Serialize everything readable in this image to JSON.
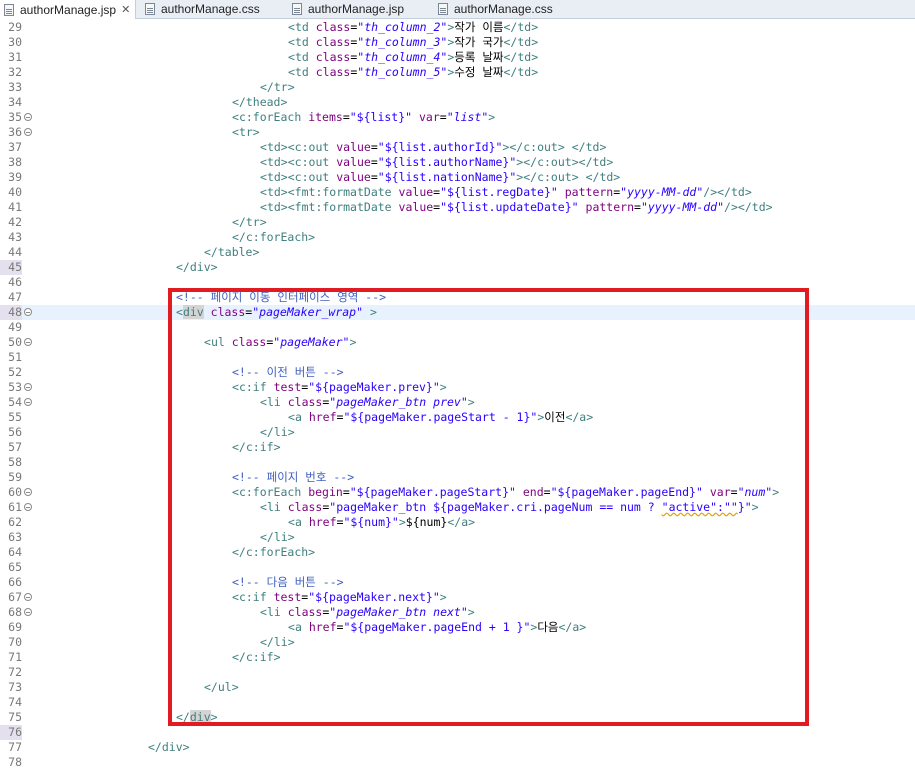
{
  "tabs": [
    {
      "label": "authorManage.jsp",
      "active": true,
      "close": "✕"
    },
    {
      "label": "authorManage.css",
      "active": false
    },
    {
      "label": "authorManage.jsp",
      "active": false
    },
    {
      "label": "authorManage.css",
      "active": false
    }
  ],
  "lines": [
    {
      "n": "29",
      "text": "<td class=\"th_column_2\">작가 이름</td>"
    },
    {
      "n": "30",
      "text": "<td class=\"th_column_3\">작가 국가</td>"
    },
    {
      "n": "31",
      "text": "<td class=\"th_column_4\">등록 날짜</td>"
    },
    {
      "n": "32",
      "text": "<td class=\"th_column_5\">수정 날짜</td>"
    },
    {
      "n": "33",
      "text": "</tr>"
    },
    {
      "n": "34",
      "text": "</thead>"
    },
    {
      "n": "35",
      "text": "<c:forEach items=\"${list}\" var=\"list\">"
    },
    {
      "n": "36",
      "text": "<tr>"
    },
    {
      "n": "37",
      "text": "<td><c:out value=\"${list.authorId}\"></c:out> </td>"
    },
    {
      "n": "38",
      "text": "<td><c:out value=\"${list.authorName}\"></c:out></td>"
    },
    {
      "n": "39",
      "text": "<td><c:out value=\"${list.nationName}\"></c:out> </td>"
    },
    {
      "n": "40",
      "text": "<td><fmt:formatDate value=\"${list.regDate}\" pattern=\"yyyy-MM-dd\"/></td>"
    },
    {
      "n": "41",
      "text": "<td><fmt:formatDate value=\"${list.updateDate}\" pattern=\"yyyy-MM-dd\"/></td>"
    },
    {
      "n": "42",
      "text": "</tr>"
    },
    {
      "n": "43",
      "text": "</c:forEach>"
    },
    {
      "n": "44",
      "text": "</table>"
    },
    {
      "n": "45",
      "text": "</div>"
    },
    {
      "n": "46",
      "text": ""
    },
    {
      "n": "47",
      "text": "<!-- 페이지 이동 인터페이스 영역 -->"
    },
    {
      "n": "48",
      "text": "<div class=\"pageMaker_wrap\" >"
    },
    {
      "n": "49",
      "text": ""
    },
    {
      "n": "50",
      "text": "<ul class=\"pageMaker\">"
    },
    {
      "n": "51",
      "text": ""
    },
    {
      "n": "52",
      "text": "<!-- 이전 버튼 -->"
    },
    {
      "n": "53",
      "text": "<c:if test=\"${pageMaker.prev}\">"
    },
    {
      "n": "54",
      "text": "<li class=\"pageMaker_btn prev\">"
    },
    {
      "n": "55",
      "text": "<a href=\"${pageMaker.pageStart - 1}\">이전</a>"
    },
    {
      "n": "56",
      "text": "</li>"
    },
    {
      "n": "57",
      "text": "</c:if>"
    },
    {
      "n": "58",
      "text": ""
    },
    {
      "n": "59",
      "text": "<!-- 페이지 번호 -->"
    },
    {
      "n": "60",
      "text": "<c:forEach begin=\"${pageMaker.pageStart}\" end=\"${pageMaker.pageEnd}\" var=\"num\">"
    },
    {
      "n": "61",
      "text": "<li class=\"pageMaker_btn ${pageMaker.cri.pageNum == num ? \"active\":\"\"}\">"
    },
    {
      "n": "62",
      "text": "<a href=\"${num}\">${num}</a>"
    },
    {
      "n": "63",
      "text": "</li>"
    },
    {
      "n": "64",
      "text": "</c:forEach>"
    },
    {
      "n": "65",
      "text": ""
    },
    {
      "n": "66",
      "text": "<!-- 다음 버튼 -->"
    },
    {
      "n": "67",
      "text": "<c:if test=\"${pageMaker.next}\">"
    },
    {
      "n": "68",
      "text": "<li class=\"pageMaker_btn next\">"
    },
    {
      "n": "69",
      "text": "<a href=\"${pageMaker.pageEnd + 1 }\">다음</a>"
    },
    {
      "n": "70",
      "text": "</li>"
    },
    {
      "n": "71",
      "text": "</c:if>"
    },
    {
      "n": "72",
      "text": ""
    },
    {
      "n": "73",
      "text": "</ul>"
    },
    {
      "n": "74",
      "text": ""
    },
    {
      "n": "75",
      "text": "</div>"
    },
    {
      "n": "76",
      "text": ""
    },
    {
      "n": "77",
      "text": "</div>"
    },
    {
      "n": "78",
      "text": ""
    }
  ],
  "colors": {
    "annotation_box": "#e21b22",
    "current_line": "#e8f2fe"
  }
}
